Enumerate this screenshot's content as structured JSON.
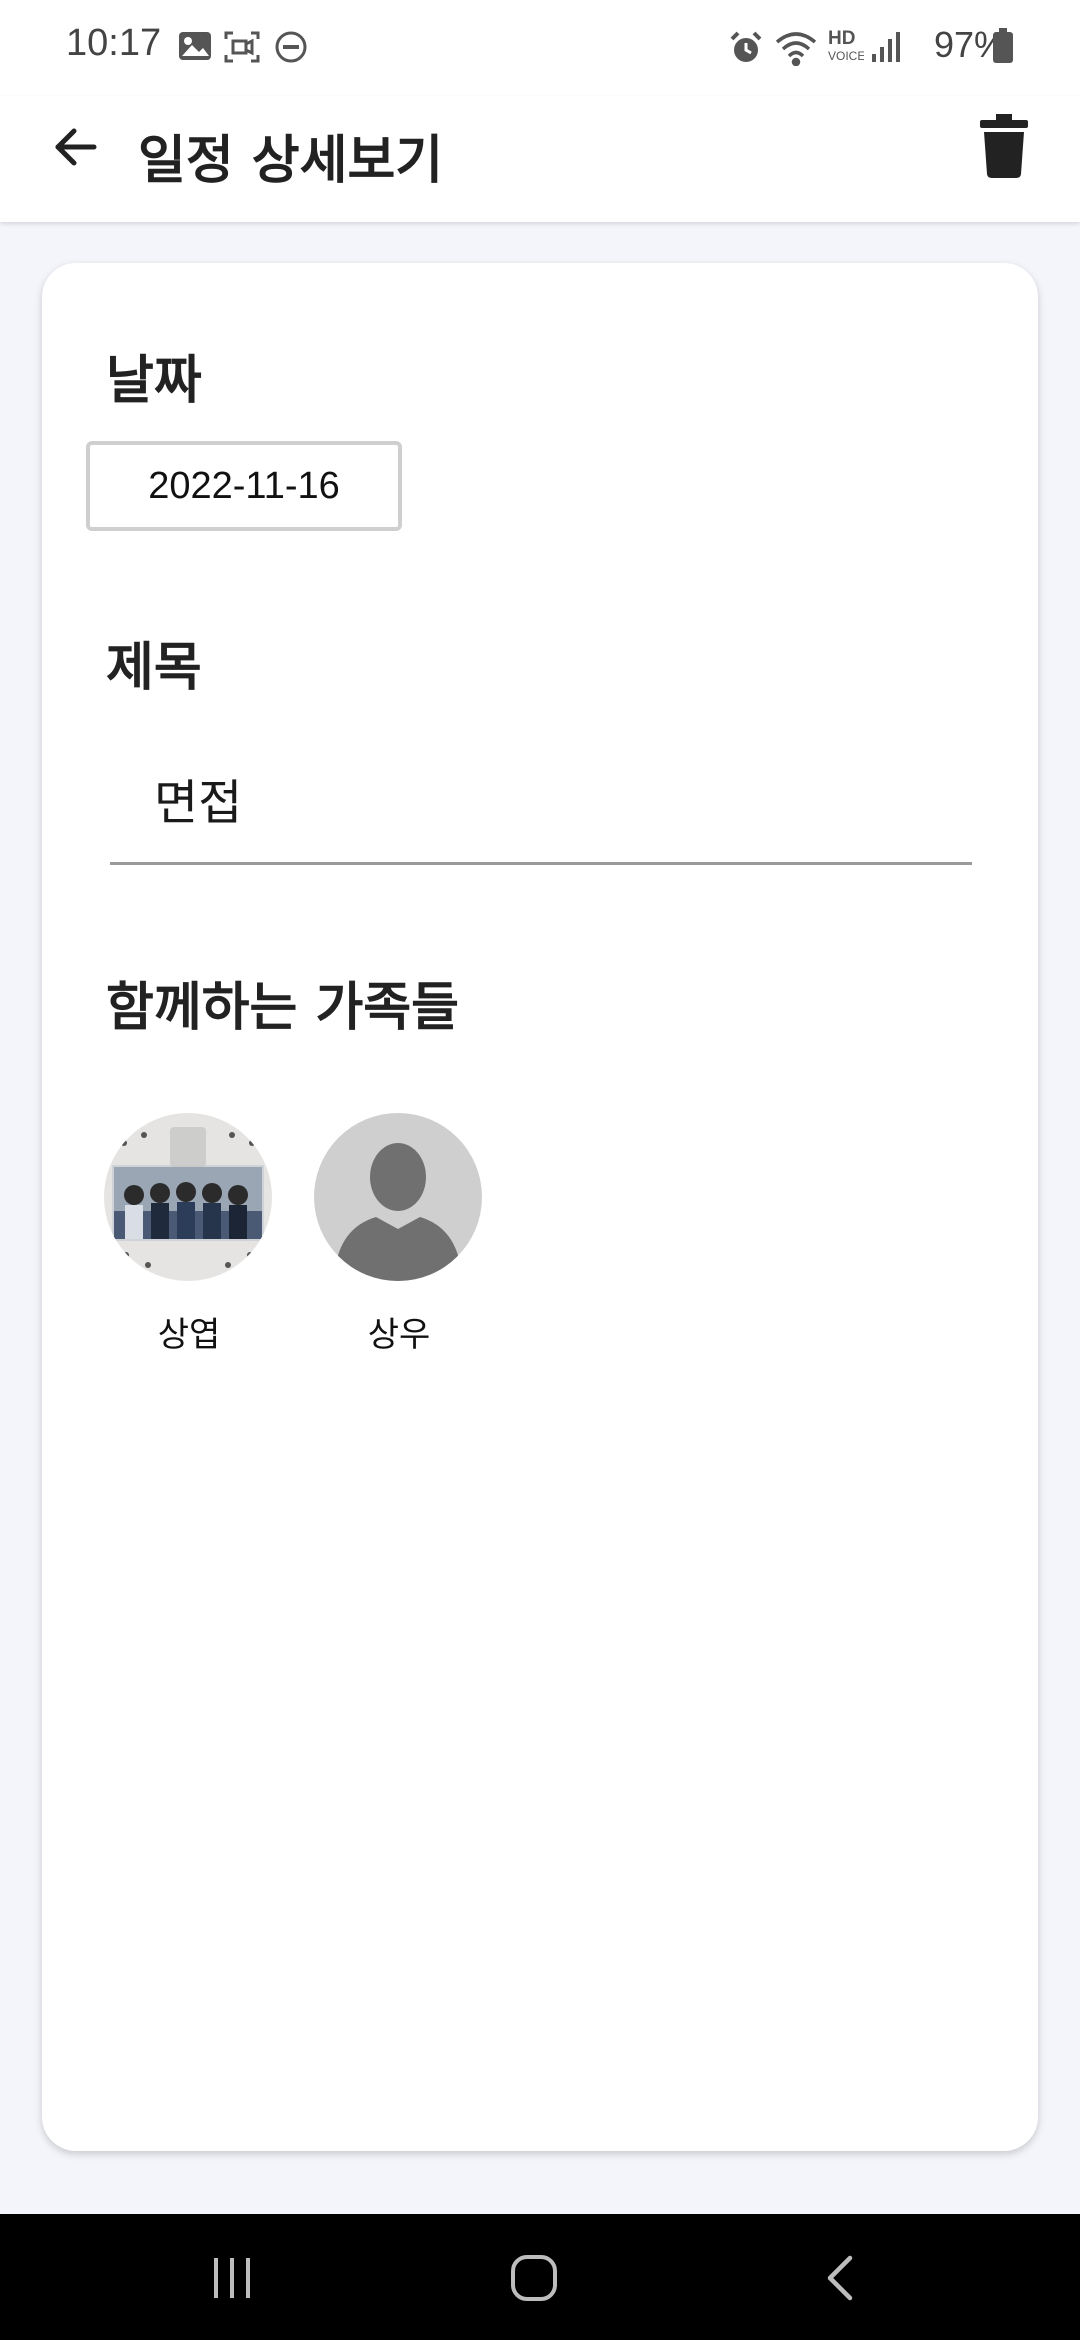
{
  "status_bar": {
    "time": "10:17",
    "battery": "97%",
    "left_icons": [
      "gallery-icon",
      "screen-record-icon",
      "do-not-disturb-icon"
    ],
    "right_icons": [
      "alarm-icon",
      "wifi-icon",
      "hd-voice-icon",
      "signal-icon",
      "battery-icon"
    ],
    "hd_voice_label": "HD"
  },
  "header": {
    "title": "일정 상세보기",
    "back_icon": "arrow-left-icon",
    "delete_icon": "trash-icon"
  },
  "detail": {
    "date_label": "날짜",
    "date_value": "2022-11-16",
    "title_label": "제목",
    "title_value": "면접",
    "family_label": "함께하는 가족들",
    "members": [
      {
        "name": "상엽",
        "avatar": "group-photo"
      },
      {
        "name": "상우",
        "avatar": "default-person-icon"
      }
    ]
  },
  "colors": {
    "background": "#f3f5fa",
    "card": "#ffffff",
    "title_text": "#222222",
    "nav_bar": "#000000"
  }
}
